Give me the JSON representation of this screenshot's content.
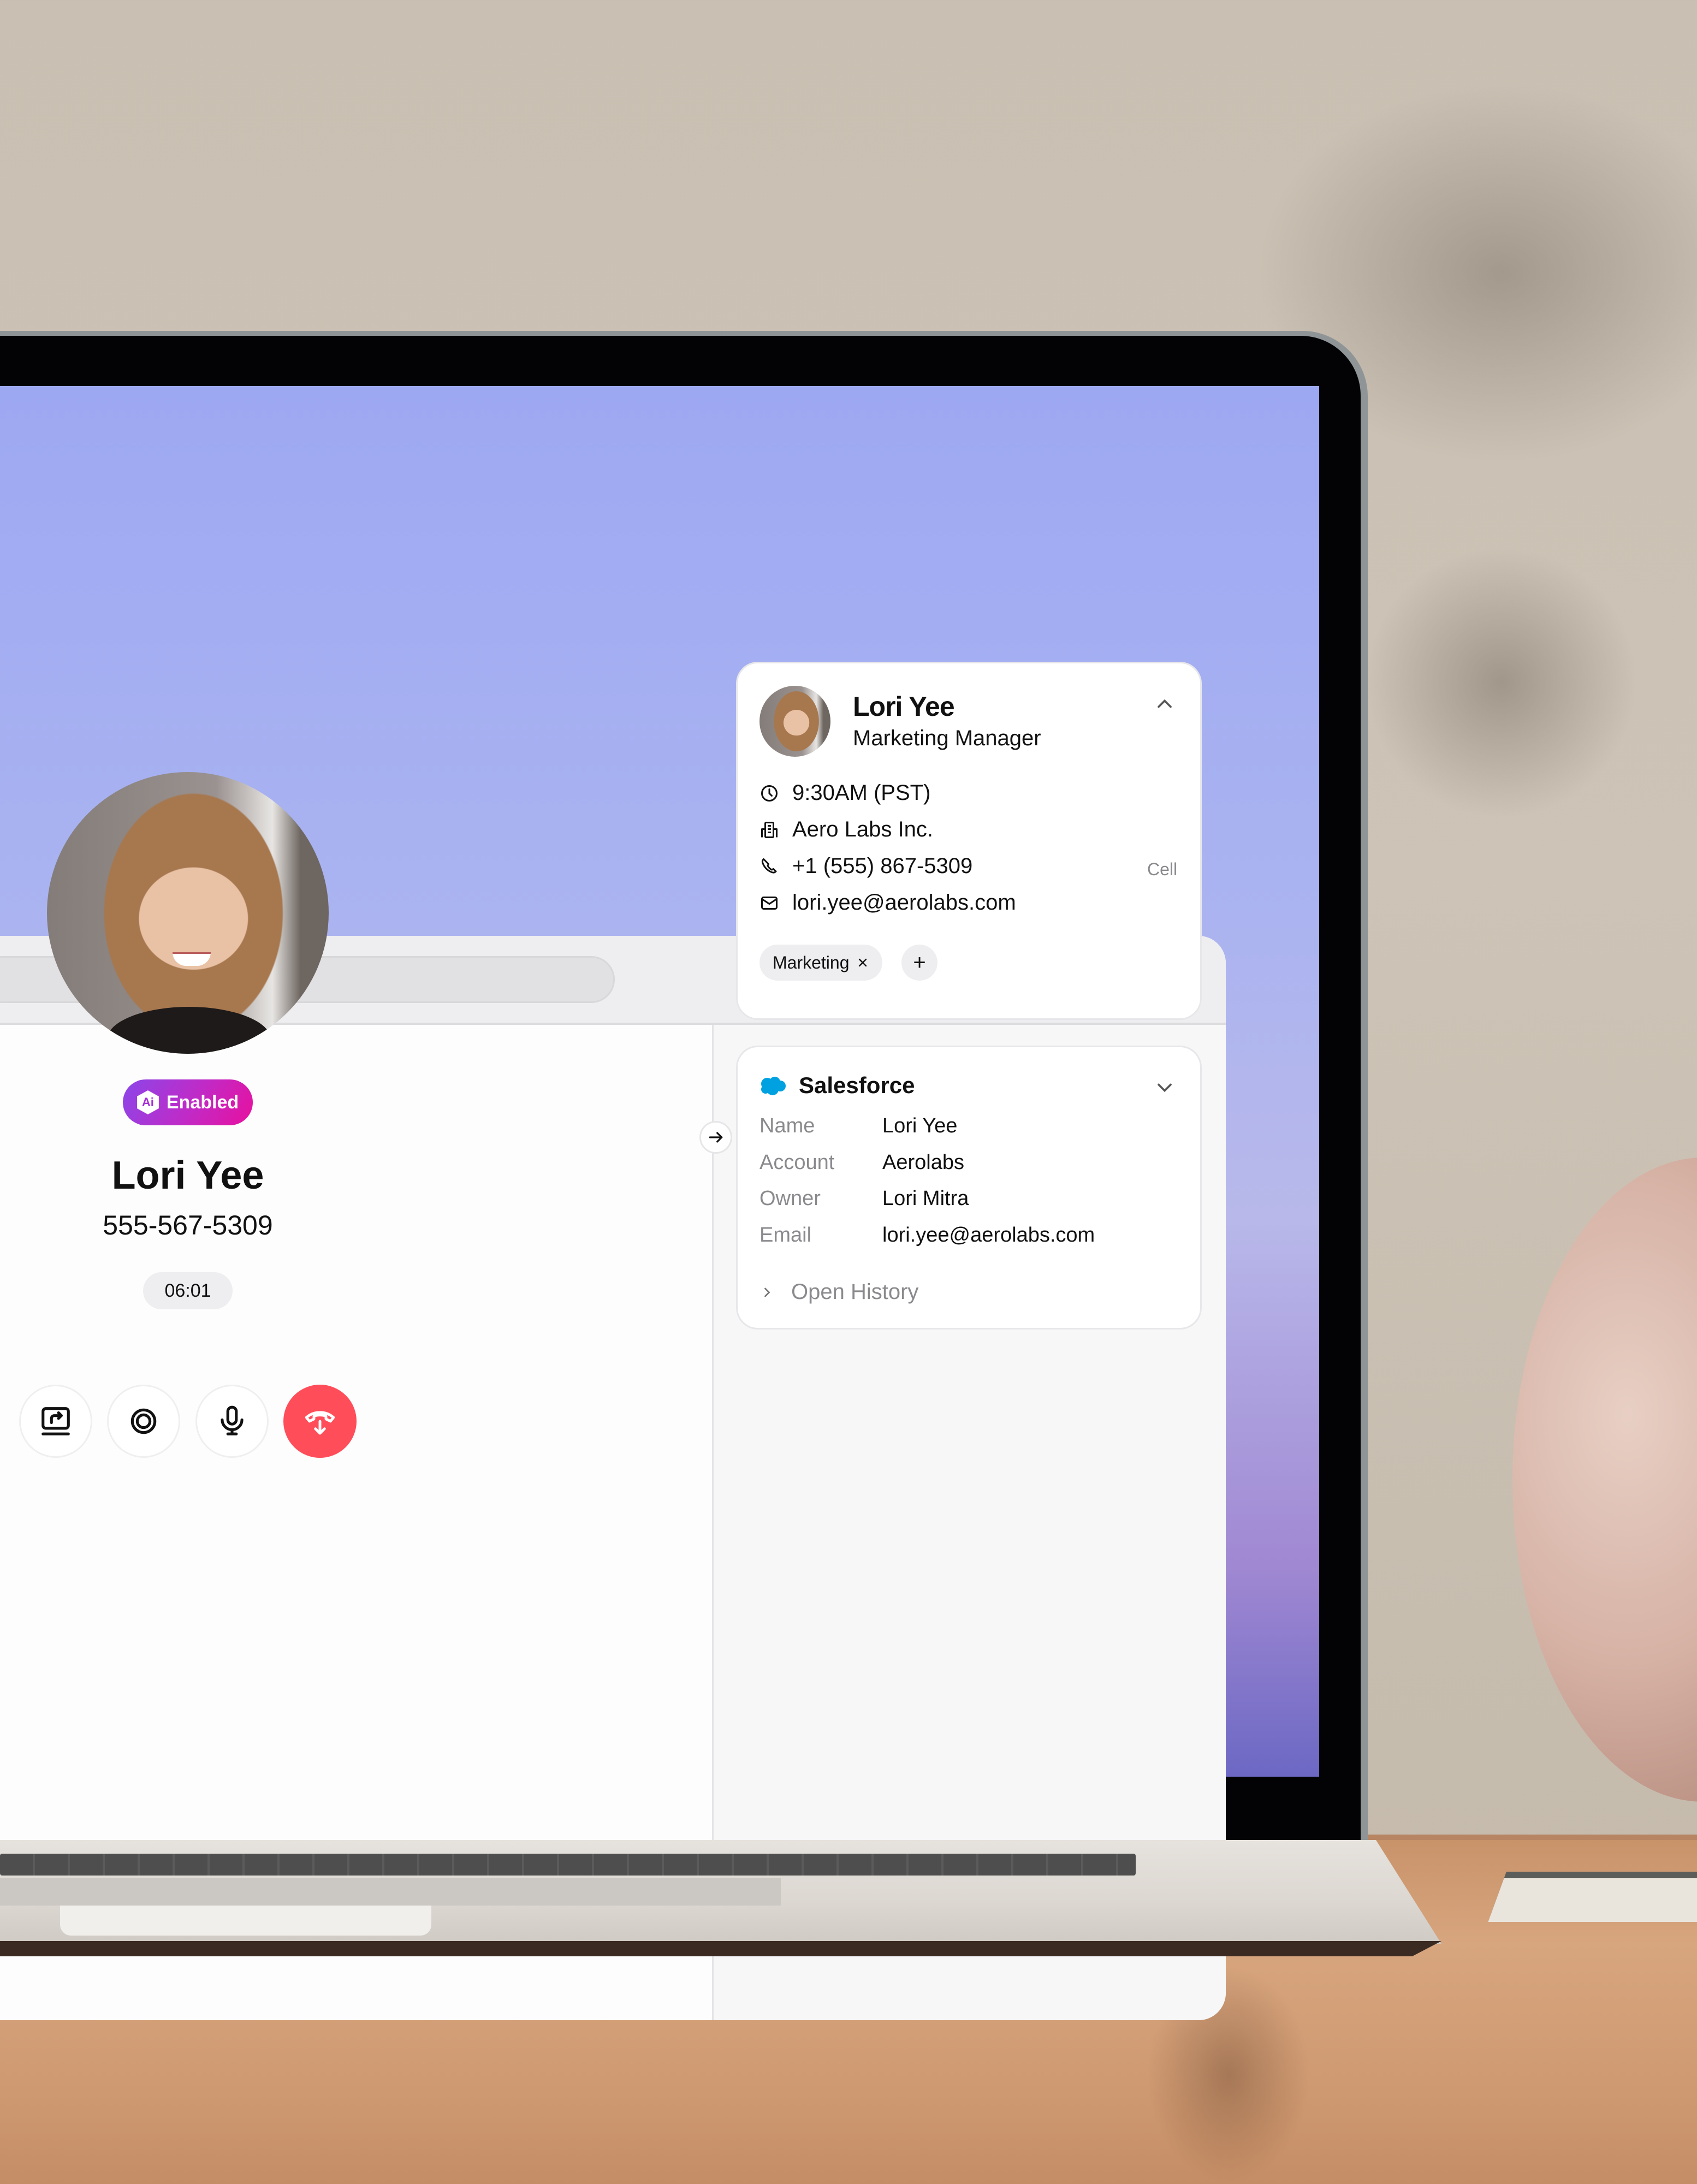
{
  "topbar": {
    "search_value": "",
    "search_placeholder": "",
    "user_status": "online"
  },
  "call": {
    "ai_badge_label": "Enabled",
    "ai_badge_icon_text": "Ai",
    "caller_name": "Lori Yee",
    "caller_phone": "555-567-5309",
    "duration": "06:01",
    "controls": [
      {
        "name": "share-screen",
        "icon": "share-screen-icon"
      },
      {
        "name": "record",
        "icon": "record-icon"
      },
      {
        "name": "mute",
        "icon": "microphone-icon"
      },
      {
        "name": "end-call",
        "icon": "hang-up-icon"
      }
    ],
    "colors": {
      "end_call": "#ff4d5a",
      "badge_start": "#8b46ea",
      "badge_end": "#e8109e",
      "status_online": "#22b04b"
    }
  },
  "contact_card": {
    "name": "Lori Yee",
    "title": "Marketing Manager",
    "local_time": "9:30AM (PST)",
    "company": "Aero Labs Inc.",
    "phone": "+1 (555) 867-5309",
    "phone_type": "Cell",
    "email": "lori.yee@aerolabs.com",
    "tags": [
      "Marketing"
    ],
    "add_tag_label": "+"
  },
  "salesforce": {
    "title": "Salesforce",
    "brand_color": "#00a1e0",
    "fields": [
      {
        "label": "Name",
        "value": "Lori Yee"
      },
      {
        "label": "Account",
        "value": "Aerolabs"
      },
      {
        "label": "Owner",
        "value": "Lori Mitra"
      },
      {
        "label": "Email",
        "value": "lori.yee@aerolabs.com"
      }
    ],
    "open_history_label": "Open History"
  }
}
